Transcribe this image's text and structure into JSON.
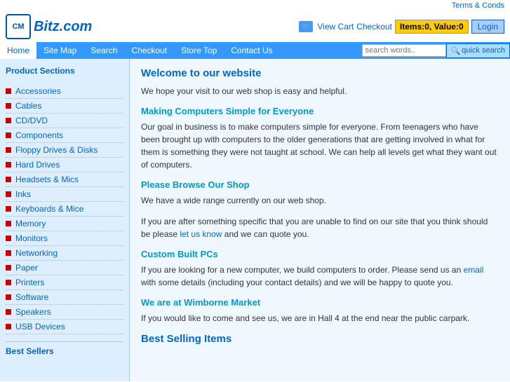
{
  "topbar": {
    "terms_link": "Terms & Conds"
  },
  "header": {
    "logo_letters": "CM",
    "logo_site": "Bitz.com",
    "cart_label": "View Cart",
    "checkout_label": "Checkout",
    "items_badge": "Items:0, Value:0",
    "login_label": "Login",
    "search_placeholder": "search words..",
    "quick_search_label": "quick search"
  },
  "nav": {
    "items": [
      {
        "label": "Home",
        "active": true
      },
      {
        "label": "Site Map",
        "active": false
      },
      {
        "label": "Search",
        "active": false
      },
      {
        "label": "Checkout",
        "active": false
      },
      {
        "label": "Store Top",
        "active": false
      },
      {
        "label": "Contact Us",
        "active": false
      }
    ]
  },
  "sidebar": {
    "section_title": "Product Sections",
    "items": [
      {
        "label": "Accessories"
      },
      {
        "label": "Cables"
      },
      {
        "label": "CD/DVD"
      },
      {
        "label": "Components"
      },
      {
        "label": "Floppy Drives & Disks"
      },
      {
        "label": "Hard Drives"
      },
      {
        "label": "Headsets & Mics"
      },
      {
        "label": "Inks"
      },
      {
        "label": "Keyboards & Mice"
      },
      {
        "label": "Memory"
      },
      {
        "label": "Monitors"
      },
      {
        "label": "Networking"
      },
      {
        "label": "Paper"
      },
      {
        "label": "Printers"
      },
      {
        "label": "Software"
      },
      {
        "label": "Speakers"
      },
      {
        "label": "USB Devices"
      }
    ],
    "section2_title": "Best Sellers"
  },
  "content": {
    "welcome_title": "Welcome to our website",
    "welcome_text": "We hope your visit to our web shop is easy and helpful.",
    "section1_title": "Making Computers Simple for Everyone",
    "section1_text": "Our goal in business is to make computers simple for everyone. From teenagers who have been brought up with computers to the older generations that are getting involved in what for them is something they were not taught at school. We can help all levels get what they want out of computers.",
    "section2_title": "Please Browse Our Shop",
    "section2_text1": "We have a wide range currently on our web shop.",
    "section2_text2": "If you are after something specific that you are unable to find on our site that you think should be please",
    "section2_link": "let us know",
    "section2_text3": "and we can quote you.",
    "section3_title": "Custom Built PCs",
    "section3_text1": "If you are looking for a new computer, we build computers to order. Please send us an",
    "section3_link": "email",
    "section3_text2": "with some details (including your contact details) and we will be happy to quote you.",
    "section4_title": "We are at Wimborne Market",
    "section4_text": "If you would like to come and see us, we are in Hall 4 at the end near the public carpark.",
    "best_selling_title": "Best Selling Items"
  }
}
